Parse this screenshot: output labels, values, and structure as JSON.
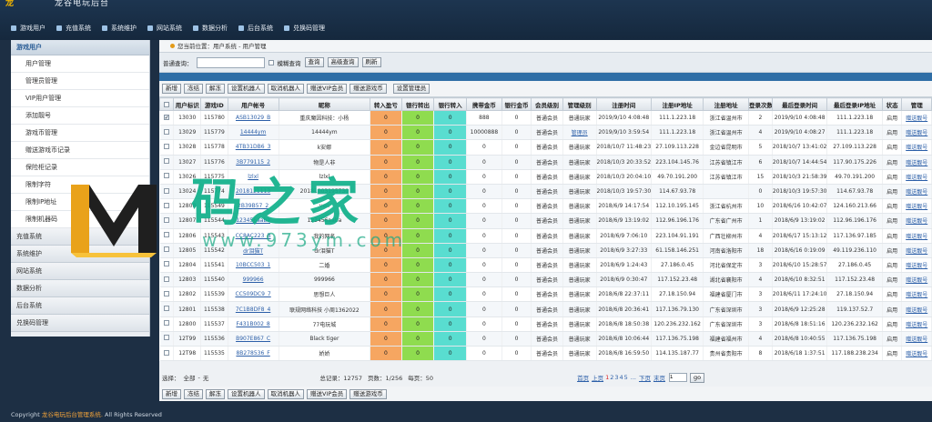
{
  "app": {
    "logo_mark": "龙",
    "title": "龙谷电玩后台"
  },
  "topnav": [
    "游戏用户",
    "充值系统",
    "系统维护",
    "网站系统",
    "数据分析",
    "后台系统",
    "兑换码管理"
  ],
  "sidebar": {
    "head": "游戏用户",
    "subs": [
      "用户管理",
      "管理员管理",
      "VIP用户管理",
      "添加靓号",
      "游戏币管理",
      "赠送游戏币记录",
      "保险柜记录",
      "限制字符",
      "限制IP地址",
      "限制机器码"
    ],
    "groups": [
      "充值系统",
      "系统维护",
      "网站系统",
      "数据分析",
      "后台系统",
      "兑换码管理"
    ]
  },
  "watermark": {
    "text": "码之家",
    "url": "www.973ym.com"
  },
  "breadcrumb": "您当前位置：用户系统 - 用户管理",
  "search": {
    "label": "普通查询：",
    "value": "",
    "fuzzy_label": "模糊查询",
    "query_button": "查询",
    "advanced_button": "高级查询",
    "refresh_button": "刷新"
  },
  "toolbar": [
    "新增",
    "冻结",
    "解冻",
    "设置机器人",
    "取消机器人",
    "赠送VIP会员",
    "赠送游戏币",
    "设置管理员"
  ],
  "bottom_toolbar": [
    "新增",
    "冻结",
    "解冻",
    "设置机器人",
    "取消机器人",
    "赠送VIP会员",
    "赠送游戏币"
  ],
  "table": {
    "columns": [
      "用户标识",
      "游戏ID",
      "用户帐号",
      "昵称",
      "转入盈亏",
      "银行转出",
      "银行转入",
      "携带金币",
      "银行金币",
      "会员级别",
      "管理级别",
      "注册时间",
      "注册IP地址",
      "注册地址",
      "登录次数",
      "最后登录时间",
      "最后登录IP地址",
      "状态",
      "管理"
    ],
    "rows": [
      [
        "13030",
        "115780",
        "ASB13029_B",
        "重庆魔因科技：小杨",
        "0",
        "0",
        "0",
        "888",
        "0",
        "普通会员",
        "普通玩家",
        "2019/9/10 4:08:48",
        "111.1.223.18",
        "浙江省温州市",
        "2",
        "2019/9/10 4:08:48",
        "111.1.223.18",
        "启用",
        "赠送靓号"
      ],
      [
        "13029",
        "115779",
        "14444ym",
        "14444ym",
        "0",
        "0",
        "0",
        "10000888",
        "0",
        "普通会员",
        "管理员",
        "2019/9/10 3:59:54",
        "111.1.223.18",
        "浙江省温州市",
        "4",
        "2019/9/10 4:08:27",
        "111.1.223.18",
        "启用",
        "赠送靓号"
      ],
      [
        "13028",
        "115778",
        "4TB31DB6_3",
        "k安娜",
        "0",
        "0",
        "0",
        "0",
        "0",
        "普通会员",
        "普通玩家",
        "2018/10/7 11:48:23",
        "27.109.113.228",
        "金边省昆明市",
        "5",
        "2018/10/7 13:41:02",
        "27.109.113.228",
        "启用",
        "赠送靓号"
      ],
      [
        "13027",
        "115776",
        "3B779115_2",
        "物是人非",
        "0",
        "0",
        "0",
        "0",
        "0",
        "普通会员",
        "普通玩家",
        "2018/10/3 20:33:52",
        "223.104.145.76",
        "江苏省镇江市",
        "6",
        "2018/10/7 14:44:54",
        "117.90.175.226",
        "启用",
        "赠送靓号"
      ],
      [
        "13026",
        "115775",
        "lzlxl",
        "lzlxl",
        "0",
        "0",
        "0",
        "0",
        "0",
        "普通会员",
        "普通玩家",
        "2018/10/3 20:04:10",
        "49.70.191.200",
        "江苏省镇江市",
        "15",
        "2018/10/3 21:58:39",
        "49.70.191.200",
        "启用",
        "赠送靓号"
      ],
      [
        "13024",
        "115774",
        "2018121113",
        "20181003195730",
        "0",
        "0",
        "0",
        "0",
        "0",
        "普通会员",
        "普通玩家",
        "2018/10/3 19:57:30",
        "114.67.93.78",
        "",
        "0",
        "2018/10/3 19:57:30",
        "114.67.93.78",
        "启用",
        "赠送靓号"
      ],
      [
        "12808",
        "115549",
        "2B39B57_2",
        "ven",
        "0",
        "0",
        "0",
        "0",
        "0",
        "普通会员",
        "普通玩家",
        "2018/6/9 14:17:54",
        "112.10.195.145",
        "浙江省杭州市",
        "10",
        "2018/6/16 10:42:07",
        "124.160.213.66",
        "启用",
        "赠送靓号"
      ],
      [
        "12807",
        "115544",
        "123456aaba",
        "123456aaba",
        "0",
        "0",
        "0",
        "0",
        "0",
        "普通会员",
        "普通玩家",
        "2018/6/9 13:19:02",
        "112.96.196.176",
        "广东省广州市",
        "1",
        "2018/6/9 13:19:02",
        "112.96.196.176",
        "启用",
        "赠送靓号"
      ],
      [
        "12806",
        "115543",
        "CC8AC223_B",
        "我的网名",
        "0",
        "0",
        "0",
        "0",
        "0",
        "普通会员",
        "普通玩家",
        "2018/6/9 7:06:10",
        "223.104.91.191",
        "广西壮柳州市",
        "4",
        "2018/6/17 15:13:12",
        "117.136.97.185",
        "启用",
        "赠送靓号"
      ],
      [
        "12805",
        "115542",
        "dr泪猫T",
        "dr泪猫T",
        "0",
        "0",
        "0",
        "0",
        "0",
        "普通会员",
        "普通玩家",
        "2018/6/9 3:27:33",
        "61.158.146.251",
        "河南省洛阳市",
        "18",
        "2018/6/16 0:19:09",
        "49.119.236.110",
        "启用",
        "赠送靓号"
      ],
      [
        "12804",
        "115541",
        "10BCC503_1",
        "二婚",
        "0",
        "0",
        "0",
        "0",
        "0",
        "普通会员",
        "普通玩家",
        "2018/6/9 1:24:43",
        "27.186.0.45",
        "河北省保定市",
        "3",
        "2018/6/10 15:28:57",
        "27.186.0.45",
        "启用",
        "赠送靓号"
      ],
      [
        "12803",
        "115540",
        "999966",
        "999966",
        "0",
        "0",
        "0",
        "0",
        "0",
        "普通会员",
        "普通玩家",
        "2018/6/9 0:30:47",
        "117.152.23.48",
        "湖北省襄阳市",
        "4",
        "2018/6/10 8:32:51",
        "117.152.23.48",
        "启用",
        "赠送靓号"
      ],
      [
        "12802",
        "115539",
        "CC509DC9_7",
        "思想巨人",
        "0",
        "0",
        "0",
        "0",
        "0",
        "普通会员",
        "普通玩家",
        "2018/6/8 22:37:11",
        "27.18.150.94",
        "福建省厦门市",
        "3",
        "2018/6/11 17:24:10",
        "27.18.150.94",
        "启用",
        "赠送靓号"
      ],
      [
        "12801",
        "115538",
        "7C1B8DF8_4",
        "联规网络科技 小周1362022",
        "0",
        "0",
        "0",
        "0",
        "0",
        "普通会员",
        "普通玩家",
        "2018/6/8 20:36:41",
        "117.136.79.130",
        "广东省深圳市",
        "3",
        "2018/6/9 12:25:28",
        "119.137.52.7",
        "启用",
        "赠送靓号"
      ],
      [
        "12800",
        "115537",
        "F431B002_8",
        "77电玩城",
        "0",
        "0",
        "0",
        "0",
        "0",
        "普通会员",
        "普通玩家",
        "2018/6/8 18:50:38",
        "120.236.232.162",
        "广东省深圳市",
        "3",
        "2018/6/8 18:51:16",
        "120.236.232.162",
        "启用",
        "赠送靓号"
      ],
      [
        "12T99",
        "115536",
        "B907E867_C",
        "Black tiger",
        "0",
        "0",
        "0",
        "0",
        "0",
        "普通会员",
        "普通玩家",
        "2018/6/8 10:06:44",
        "117.136.75.198",
        "福建省福州市",
        "4",
        "2018/6/8 10:40:55",
        "117.136.75.198",
        "启用",
        "赠送靓号"
      ],
      [
        "12T98",
        "115535",
        "8B278536_F",
        "娇娇",
        "0",
        "0",
        "0",
        "0",
        "0",
        "普通会员",
        "普通玩家",
        "2018/6/8 16:59:50",
        "114.135.187.77",
        "贵州省贵阳市",
        "8",
        "2018/6/18 1:37:51",
        "117.188.238.234",
        "启用",
        "赠送靓号"
      ]
    ]
  },
  "footer": {
    "select_label": "选择：",
    "select_all": "全部",
    "select_none": "无",
    "total": "总记录：12757",
    "pages": "页数：1/256",
    "per_page": "每页：50",
    "first": "首页",
    "prev": "上页",
    "page_numbers": [
      "1",
      "2",
      "3",
      "4",
      "5"
    ],
    "next_group": "...",
    "next": "下页",
    "last": "末页",
    "jump_value": "1",
    "go": "go"
  },
  "copyright": {
    "prefix": "Copyright ",
    "brand": "龙谷电玩后台管理系统.",
    "suffix": " All Rights Reserved"
  },
  "colors": {
    "in": "#f6a661",
    "out": "#8fdc4f",
    "bank": "#59ddd0",
    "accent": "#2f6ea6"
  },
  "selected_row_index": 0
}
